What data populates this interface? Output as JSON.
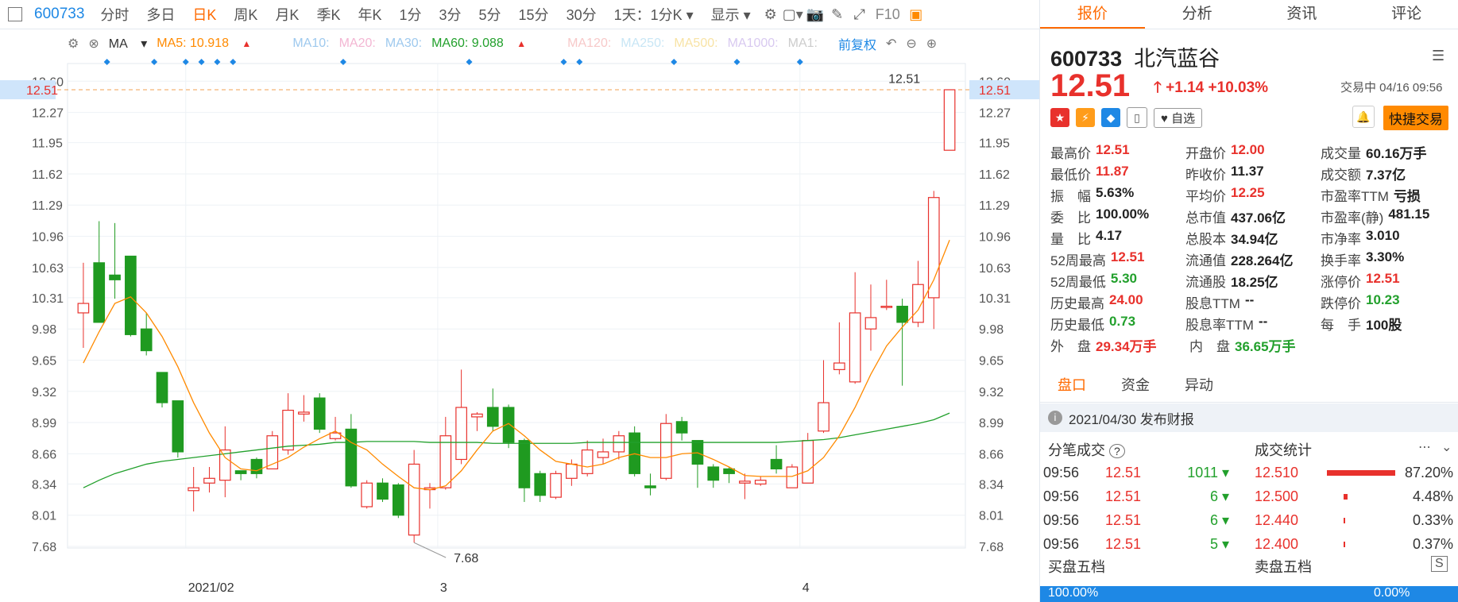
{
  "toolbar": {
    "code": "600733",
    "items": [
      "分时",
      "多日",
      "日K",
      "周K",
      "月K",
      "季K",
      "年K",
      "1分",
      "3分",
      "5分",
      "15分",
      "30分"
    ],
    "active_index": 2,
    "period_select": "1天：1分K",
    "display": "显示",
    "f10": "F10"
  },
  "ma": {
    "label": "MA",
    "ma5": "MA5: 10.918",
    "ma10": "MA10:",
    "ma20": "MA20:",
    "ma30": "MA30:",
    "ma60": "MA60: 9.088",
    "ma120": "MA120:",
    "ma250": "MA250:",
    "ma500": "MA500:",
    "ma1000": "MA1000:",
    "ma1": "MA1:",
    "adjust": "前复权",
    "colors": {
      "ma5": "#ff8a00",
      "ma60": "#22a02c",
      "muted1": "#9ec9ee",
      "muted2": "#f3b6d3",
      "muted3": "#c7e6b8",
      "muted4": "#f7c9c9",
      "muted5": "#c8e6f5",
      "muted6": "#f8e3a5",
      "muted7": "#d8c9f0"
    }
  },
  "chart_data": {
    "type": "candlestick",
    "y_ticks": [
      "12.60",
      "12.51",
      "12.27",
      "11.95",
      "11.62",
      "11.29",
      "10.96",
      "10.63",
      "10.31",
      "9.98",
      "9.65",
      "9.32",
      "8.99",
      "8.66",
      "8.34",
      "8.01",
      "7.68"
    ],
    "ylim": [
      7.68,
      12.6
    ],
    "x_labels": [
      "2021/02",
      "3",
      "4"
    ],
    "x_label_index": [
      7,
      23,
      46
    ],
    "max_label": "12.51",
    "min_label": "7.68",
    "current_price_tag": "12.51",
    "candles": [
      [
        10.15,
        10.25,
        10.68,
        9.78
      ],
      [
        10.68,
        10.05,
        11.12,
        10.05
      ],
      [
        10.55,
        10.5,
        11.1,
        10.3
      ],
      [
        10.75,
        9.92,
        10.75,
        9.9
      ],
      [
        9.98,
        9.75,
        10.15,
        9.7
      ],
      [
        9.52,
        9.2,
        9.52,
        9.15
      ],
      [
        9.22,
        8.68,
        9.22,
        8.62
      ],
      [
        8.27,
        8.3,
        8.52,
        8.05
      ],
      [
        8.35,
        8.4,
        8.52,
        8.25
      ],
      [
        8.38,
        8.7,
        8.95,
        8.2
      ],
      [
        8.48,
        8.45,
        8.48,
        8.38
      ],
      [
        8.6,
        8.45,
        8.62,
        8.4
      ],
      [
        8.5,
        8.85,
        8.9,
        8.5
      ],
      [
        8.7,
        9.12,
        9.3,
        8.65
      ],
      [
        9.08,
        9.1,
        9.28,
        9.0
      ],
      [
        9.25,
        8.92,
        9.3,
        8.88
      ],
      [
        8.82,
        8.88,
        9.05,
        8.8
      ],
      [
        8.92,
        8.32,
        9.08,
        8.3
      ],
      [
        8.1,
        8.35,
        8.38,
        8.08
      ],
      [
        8.35,
        8.18,
        8.4,
        8.15
      ],
      [
        8.33,
        8.01,
        8.35,
        7.98
      ],
      [
        7.8,
        8.55,
        8.7,
        7.72
      ],
      [
        8.28,
        8.3,
        8.35,
        8.08
      ],
      [
        8.3,
        8.85,
        9.05,
        8.28
      ],
      [
        8.6,
        9.15,
        9.55,
        8.55
      ],
      [
        9.05,
        9.08,
        9.1,
        8.9
      ],
      [
        9.15,
        8.95,
        9.35,
        8.9
      ],
      [
        9.15,
        8.78,
        9.18,
        8.72
      ],
      [
        8.8,
        8.3,
        8.82,
        8.15
      ],
      [
        8.45,
        8.22,
        8.48,
        8.15
      ],
      [
        8.2,
        8.45,
        8.48,
        8.18
      ],
      [
        8.4,
        8.55,
        8.6,
        8.32
      ],
      [
        8.45,
        8.7,
        8.8,
        8.42
      ],
      [
        8.62,
        8.68,
        8.82,
        8.55
      ],
      [
        8.68,
        8.85,
        8.9,
        8.6
      ],
      [
        8.88,
        8.45,
        8.95,
        8.42
      ],
      [
        8.32,
        8.3,
        8.45,
        8.22
      ],
      [
        8.4,
        8.98,
        9.08,
        8.38
      ],
      [
        9.0,
        8.88,
        9.05,
        8.8
      ],
      [
        8.8,
        8.55,
        8.8,
        8.3
      ],
      [
        8.52,
        8.38,
        8.55,
        8.3
      ],
      [
        8.5,
        8.45,
        8.52,
        8.35
      ],
      [
        8.35,
        8.37,
        8.45,
        8.18
      ],
      [
        8.34,
        8.38,
        8.42,
        8.32
      ],
      [
        8.6,
        8.5,
        8.75,
        8.45
      ],
      [
        8.3,
        8.52,
        8.55,
        8.3
      ],
      [
        8.35,
        8.8,
        8.88,
        8.35
      ],
      [
        8.9,
        9.2,
        9.65,
        8.88
      ],
      [
        9.55,
        9.62,
        10.05,
        9.5
      ],
      [
        9.42,
        10.15,
        10.58,
        9.4
      ],
      [
        9.98,
        10.1,
        10.45,
        9.75
      ],
      [
        10.22,
        10.22,
        10.5,
        10.18
      ],
      [
        10.22,
        10.05,
        10.3,
        9.38
      ],
      [
        10.05,
        10.45,
        10.7,
        10.0
      ],
      [
        10.31,
        11.37,
        11.44,
        9.98
      ],
      [
        11.87,
        12.51,
        12.51,
        11.87
      ]
    ],
    "ma5": [
      9.62,
      9.95,
      10.25,
      10.32,
      10.15,
      9.9,
      9.58,
      9.2,
      8.88,
      8.62,
      8.5,
      8.48,
      8.55,
      8.62,
      8.73,
      8.82,
      8.9,
      8.78,
      8.7,
      8.55,
      8.42,
      8.3,
      8.28,
      8.32,
      8.48,
      8.7,
      8.9,
      8.98,
      8.85,
      8.7,
      8.58,
      8.55,
      8.52,
      8.55,
      8.62,
      8.66,
      8.62,
      8.62,
      8.66,
      8.67,
      8.6,
      8.52,
      8.43,
      8.42,
      8.42,
      8.42,
      8.48,
      8.62,
      8.85,
      9.15,
      9.5,
      9.8,
      10.0,
      10.18,
      10.5,
      10.92
    ],
    "ma60": [
      8.3,
      8.38,
      8.45,
      8.5,
      8.55,
      8.58,
      8.6,
      8.62,
      8.64,
      8.66,
      8.68,
      8.7,
      8.72,
      8.74,
      8.75,
      8.76,
      8.78,
      8.78,
      8.79,
      8.79,
      8.79,
      8.79,
      8.78,
      8.78,
      8.78,
      8.78,
      8.77,
      8.77,
      8.77,
      8.77,
      8.77,
      8.77,
      8.78,
      8.78,
      8.78,
      8.78,
      8.78,
      8.78,
      8.78,
      8.78,
      8.78,
      8.78,
      8.78,
      8.78,
      8.78,
      8.79,
      8.8,
      8.81,
      8.83,
      8.86,
      8.89,
      8.92,
      8.95,
      8.98,
      9.02,
      9.09
    ]
  },
  "right": {
    "tabs": [
      "报价",
      "分析",
      "资讯",
      "评论"
    ],
    "code": "600733",
    "name": "北汽蓝谷",
    "price": "12.51",
    "change": "+1.14",
    "change_pct": "+10.03%",
    "status": "交易中 04/16 09:56",
    "watch": "自选",
    "quick_trade": "快捷交易",
    "quote": [
      [
        [
          "最高价",
          "12.51",
          "red"
        ],
        [
          "开盘价",
          "12.00",
          "red"
        ],
        [
          "成交量",
          "60.16万手",
          "dk"
        ]
      ],
      [
        [
          "最低价",
          "11.87",
          "red"
        ],
        [
          "昨收价",
          "11.37",
          "dk"
        ],
        [
          "成交额",
          "7.37亿",
          "dk"
        ]
      ],
      [
        [
          "振　幅",
          "5.63%",
          "dk"
        ],
        [
          "平均价",
          "12.25",
          "red"
        ],
        [
          "市盈率TTM",
          "亏损",
          "dk"
        ]
      ],
      [
        [
          "委　比",
          "100.00%",
          "dk"
        ],
        [
          "总市值",
          "437.06亿",
          "dk"
        ],
        [
          "市盈率(静)",
          "481.15",
          "dk"
        ]
      ],
      [
        [
          "量　比",
          "4.17",
          "dk"
        ],
        [
          "总股本",
          "34.94亿",
          "dk"
        ],
        [
          "市净率",
          "3.010",
          "dk"
        ]
      ],
      [
        [
          "52周最高",
          "12.51",
          "red"
        ],
        [
          "流通值",
          "228.264亿",
          "dk"
        ],
        [
          "换手率",
          "3.30%",
          "dk"
        ]
      ],
      [
        [
          "52周最低",
          "5.30",
          "grn"
        ],
        [
          "流通股",
          "18.25亿",
          "dk"
        ],
        [
          "涨停价",
          "12.51",
          "red"
        ]
      ],
      [
        [
          "历史最高",
          "24.00",
          "red"
        ],
        [
          "股息TTM",
          "--",
          "dk"
        ],
        [
          "跌停价",
          "10.23",
          "grn"
        ]
      ],
      [
        [
          "历史最低",
          "0.73",
          "grn"
        ],
        [
          "股息率TTM",
          "--",
          "dk"
        ],
        [
          "每　手",
          "100股",
          "dk"
        ]
      ],
      [
        [
          "外　盘",
          "29.34万手",
          "red"
        ],
        [
          "内　盘",
          "36.65万手",
          "grn"
        ]
      ]
    ],
    "subtabs": [
      "盘口",
      "资金",
      "异动"
    ],
    "notice": "2021/04/30  发布财报",
    "ticks_title": "分笔成交",
    "ticks": [
      [
        "09:56",
        "12.51",
        "1011"
      ],
      [
        "09:56",
        "12.51",
        "6"
      ],
      [
        "09:56",
        "12.51",
        "6"
      ],
      [
        "09:56",
        "12.51",
        "5"
      ]
    ],
    "stats_title": "成交统计",
    "stats": [
      [
        "12.510",
        "87.20%",
        0.87
      ],
      [
        "12.500",
        "4.48%",
        0.045
      ],
      [
        "12.440",
        "0.33%",
        0.004
      ],
      [
        "12.400",
        "0.37%",
        0.004
      ]
    ],
    "buy5": "买盘五档",
    "sell5": "卖盘五档",
    "buy_pct": "100.00%",
    "sell_pct": "0.00%"
  }
}
